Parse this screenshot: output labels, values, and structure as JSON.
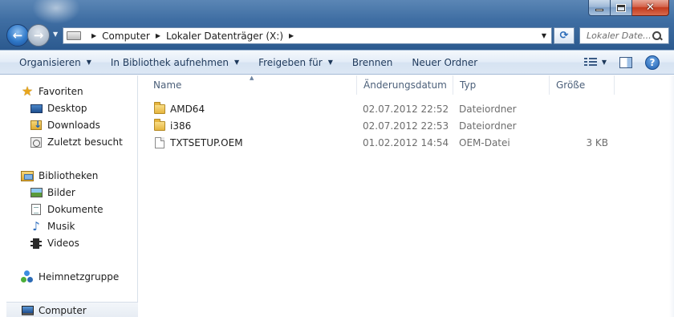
{
  "address": {
    "crumbs": [
      "Computer",
      "Lokaler Datenträger (X:)"
    ]
  },
  "search": {
    "placeholder": "Lokaler Date..."
  },
  "toolbar": {
    "organize": "Organisieren",
    "include_library": "In Bibliothek aufnehmen",
    "share": "Freigeben für",
    "burn": "Brennen",
    "new_folder": "Neuer Ordner",
    "help": "?"
  },
  "sidebar": {
    "favorites": {
      "label": "Favoriten",
      "items": [
        {
          "label": "Desktop",
          "icon": "desktop-icon"
        },
        {
          "label": "Downloads",
          "icon": "downloads-folder-icon"
        },
        {
          "label": "Zuletzt besucht",
          "icon": "recent-places-icon"
        }
      ]
    },
    "libraries": {
      "label": "Bibliotheken",
      "items": [
        {
          "label": "Bilder",
          "icon": "pictures-icon"
        },
        {
          "label": "Dokumente",
          "icon": "documents-icon"
        },
        {
          "label": "Musik",
          "icon": "music-icon"
        },
        {
          "label": "Videos",
          "icon": "videos-icon"
        }
      ]
    },
    "homegroup": {
      "label": "Heimnetzgruppe"
    },
    "computer": {
      "label": "Computer"
    }
  },
  "columns": {
    "name": "Name",
    "date": "Änderungsdatum",
    "type": "Typ",
    "size": "Größe"
  },
  "files": [
    {
      "name": "AMD64",
      "date": "02.07.2012 22:52",
      "type": "Dateiordner",
      "size": "",
      "icon": "folder-icon"
    },
    {
      "name": "i386",
      "date": "02.07.2012 22:53",
      "type": "Dateiordner",
      "size": "",
      "icon": "folder-icon"
    },
    {
      "name": "TXTSETUP.OEM",
      "date": "01.02.2012 14:54",
      "type": "OEM-Datei",
      "size": "3 KB",
      "icon": "file-icon"
    }
  ]
}
